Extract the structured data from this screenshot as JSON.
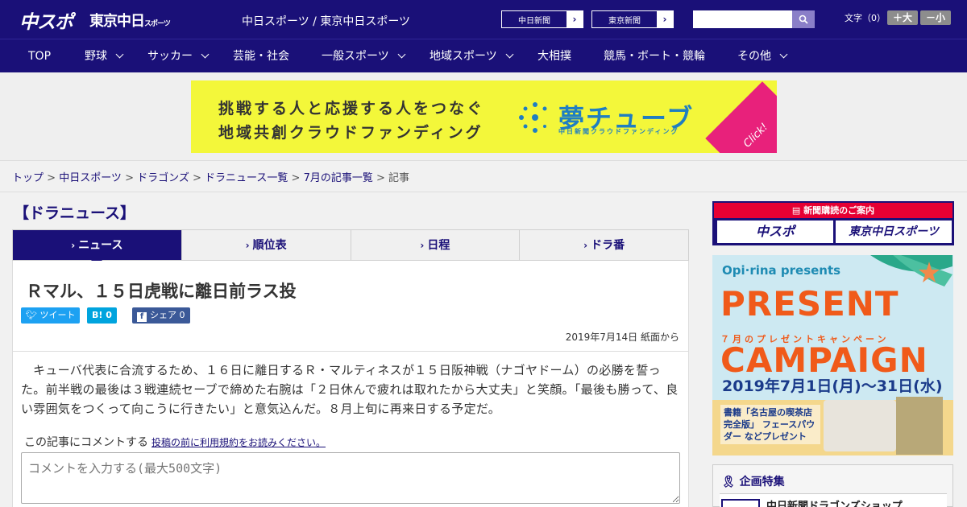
{
  "header": {
    "logo_chuspo": "中スポ",
    "logo_tokyo": "東京中日",
    "logo_tokyo_small": "スポーツ",
    "site_name": "中日スポーツ / 東京中日スポーツ",
    "paper_buttons": [
      "中日新聞",
      "東京新聞"
    ],
    "search_placeholder": "",
    "font_label": "文字（0）",
    "font_plus": "＋大",
    "font_minus": "－小"
  },
  "nav": [
    "TOP",
    "野球",
    "サッカー",
    "芸能・社会",
    "一般スポーツ",
    "地域スポーツ",
    "大相撲",
    "競馬・ボート・競輪",
    "その他"
  ],
  "banner": {
    "line1": "挑戦する人と応援する人をつなぐ",
    "line2": "地域共創クラウドファンディング",
    "brand": "夢チューブ",
    "brand_sub": "中日新聞クラウドファンディング",
    "click": "Click!"
  },
  "breadcrumb": [
    "トップ",
    "中日スポーツ",
    "ドラゴンズ",
    "ドラニュース一覧",
    "7月の記事一覧",
    "記事"
  ],
  "section_title": "【ドラニュース】",
  "tabs": [
    "ニュース",
    "順位表",
    "日程",
    "ドラ番"
  ],
  "article": {
    "headline": "Ｒマル、１５日虎戦に離日前ラス投",
    "tweet": "ツイート",
    "hatena": "B! 0",
    "share": "シェア 0",
    "date": "2019年7月14日 紙面から",
    "body": "キューバ代表に合流するため、１６日に離日するＲ・マルティネスが１５日阪神戦（ナゴヤドーム）の必勝を誓った。前半戦の最後は３戦連続セーブで締めた右腕は「２日休んで疲れは取れたから大丈夫」と笑顔。「最後も勝って、良い雰囲気をつくって向こうに行きたい」と意気込んだ。８月上旬に再来日する予定だ。",
    "comment_label": "この記事にコメントする",
    "comment_link": "投稿の前に利用規約をお読みください。",
    "comment_placeholder": "コメントを入力する(最大500文字)"
  },
  "sidebar": {
    "subscribe_header": "新聞購読のご案内",
    "subscribe_chuspo": "中スポ",
    "subscribe_tokyo": "東京中日スポーツ",
    "promo_brand": "Opi·rina presents",
    "promo_line1": "PRESENT",
    "promo_sub": "７月のプレゼントキャンペーン",
    "promo_line2": "CAMPAIGN",
    "promo_date": "2019年7月1日(月)〜31日(水)",
    "promo_gift": "書籍「名古屋の喫茶店 完全版」 フェースパウダー などプレゼント",
    "special_header": "企画特集",
    "special_item": "中日新聞ドラゴンズショップ"
  },
  "colors": {
    "brand_navy": "#1a1078",
    "banner_yellow": "#f3f73a",
    "accent_pink": "#e8217b",
    "red": "#e60033"
  }
}
